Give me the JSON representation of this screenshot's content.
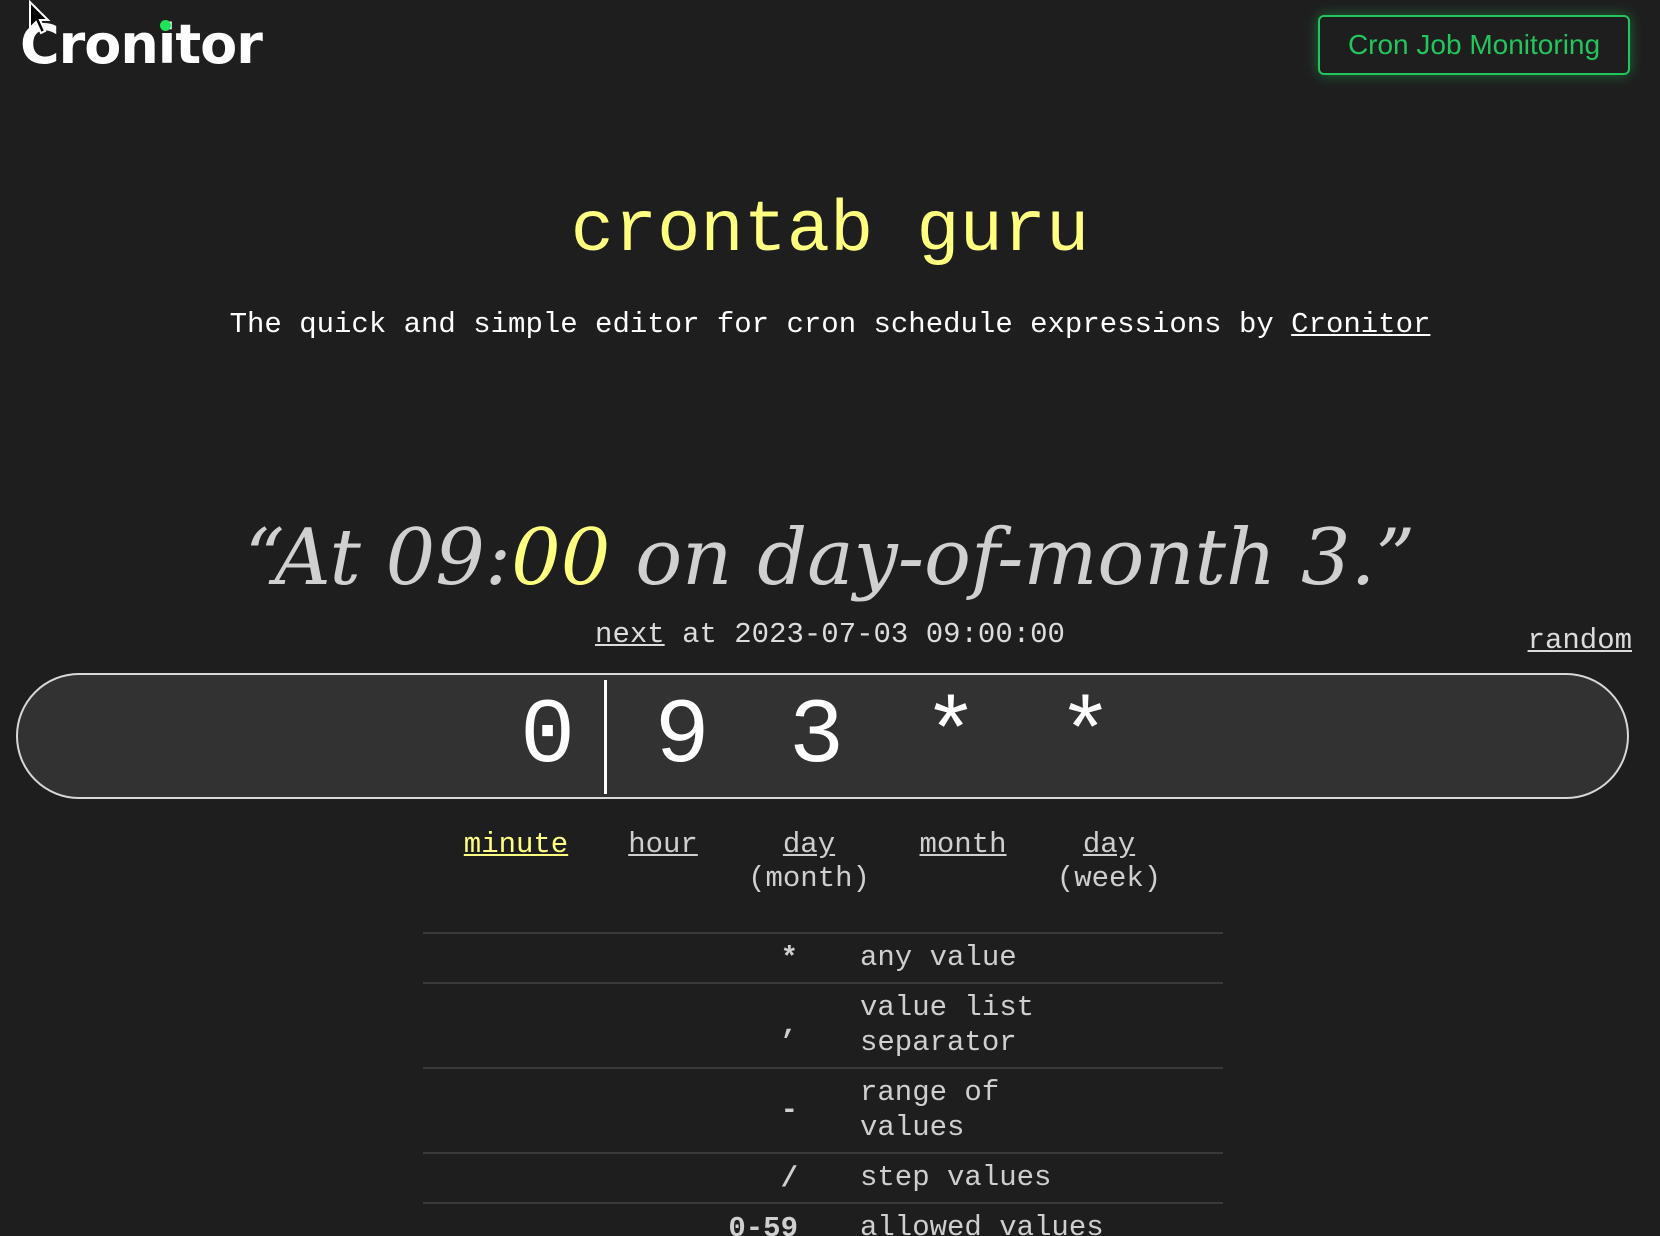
{
  "header": {
    "logo_text": "Cronitor",
    "cta_label": "Cron Job Monitoring",
    "accent_color": "#22c55e"
  },
  "hero": {
    "title": "crontab guru",
    "subtitle_prefix": "The quick and simple editor for cron schedule expressions by",
    "subtitle_link": "Cronitor"
  },
  "description": {
    "open_quote": "“",
    "part1": "At 09:",
    "highlight": "00",
    "part2": " on day-of-month 3.",
    "close_quote": "”",
    "highlight_color": "#ffff80"
  },
  "next_run": {
    "link_label": "next",
    "text": " at 2023-07-03 09:00:00"
  },
  "random_label": "random",
  "expression": {
    "value": "0 9 3 * *"
  },
  "fields": [
    {
      "name": "minute",
      "sub": "",
      "active": true
    },
    {
      "name": "hour",
      "sub": "",
      "active": false
    },
    {
      "name": "day",
      "sub": "(month)",
      "active": false
    },
    {
      "name": "month",
      "sub": "",
      "active": false
    },
    {
      "name": "day",
      "sub": "(week)",
      "active": false
    }
  ],
  "reference": [
    {
      "symbol": "*",
      "description": "any value"
    },
    {
      "symbol": ",",
      "description": "value list separator"
    },
    {
      "symbol": "-",
      "description": "range of values"
    },
    {
      "symbol": "/",
      "description": "step values"
    },
    {
      "symbol": "0-59",
      "description": "allowed values"
    }
  ]
}
